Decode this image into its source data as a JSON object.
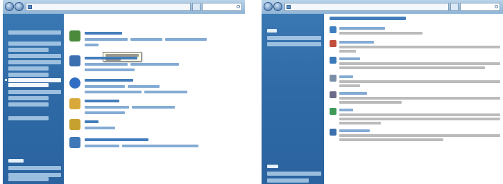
{
  "left_window": {
    "address_text": "",
    "search_placeholder": "",
    "sidebar": {
      "links": [
        "",
        "",
        "",
        "",
        "",
        "",
        "",
        "",
        "",
        "",
        "",
        "",
        ""
      ],
      "recent_tasks_heading": "",
      "recent_tasks": [
        "",
        ""
      ]
    },
    "sections": [
      {
        "icon": "personalization-icon",
        "title": "",
        "color": "#4a8a3a",
        "links": [
          "",
          "",
          "",
          ""
        ]
      },
      {
        "icon": "taskbar-icon",
        "title": "",
        "color": "#3c6fb0",
        "links": [
          "",
          "",
          ""
        ]
      },
      {
        "icon": "ease-of-access-icon",
        "title": "",
        "color": "#2f6ec4",
        "links": [
          "",
          "",
          "",
          ""
        ]
      },
      {
        "icon": "folder-options-icon",
        "title": "",
        "color": "#d8a93a",
        "links": [
          "",
          "",
          ""
        ]
      },
      {
        "icon": "fonts-icon",
        "title": "",
        "color": "#c7a12f",
        "links": [
          ""
        ]
      },
      {
        "icon": "sidebar-properties-icon",
        "title": "",
        "color": "#3f78b6",
        "links": [
          "",
          ""
        ]
      }
    ],
    "tooltip_text": ""
  },
  "right_window": {
    "address_text": "",
    "search_placeholder": "",
    "sidebar": {
      "tasks_heading": "",
      "tasks": [
        "",
        ""
      ],
      "see_also_heading": "",
      "see_also": [
        "",
        ""
      ]
    },
    "page_title": "",
    "items": [
      {
        "icon": "window-color-icon",
        "title": "",
        "color": "#3d7fc0"
      },
      {
        "icon": "desktop-background-icon",
        "title": "",
        "color": "#c14d3a"
      },
      {
        "icon": "screen-saver-icon",
        "title": "",
        "color": "#3a7ab8"
      },
      {
        "icon": "sounds-icon",
        "title": "",
        "color": "#7a8fa6"
      },
      {
        "icon": "mouse-pointers-icon",
        "title": "",
        "color": "#6a6a8a"
      },
      {
        "icon": "theme-icon",
        "title": "",
        "color": "#3f9a5a"
      },
      {
        "icon": "display-settings-icon",
        "title": "",
        "color": "#3b6fae"
      }
    ]
  },
  "colors": {
    "sidebar_blue": "#2f6aa6",
    "link_blue": "#1f5a96",
    "titlebar": "#a6c5e3"
  }
}
